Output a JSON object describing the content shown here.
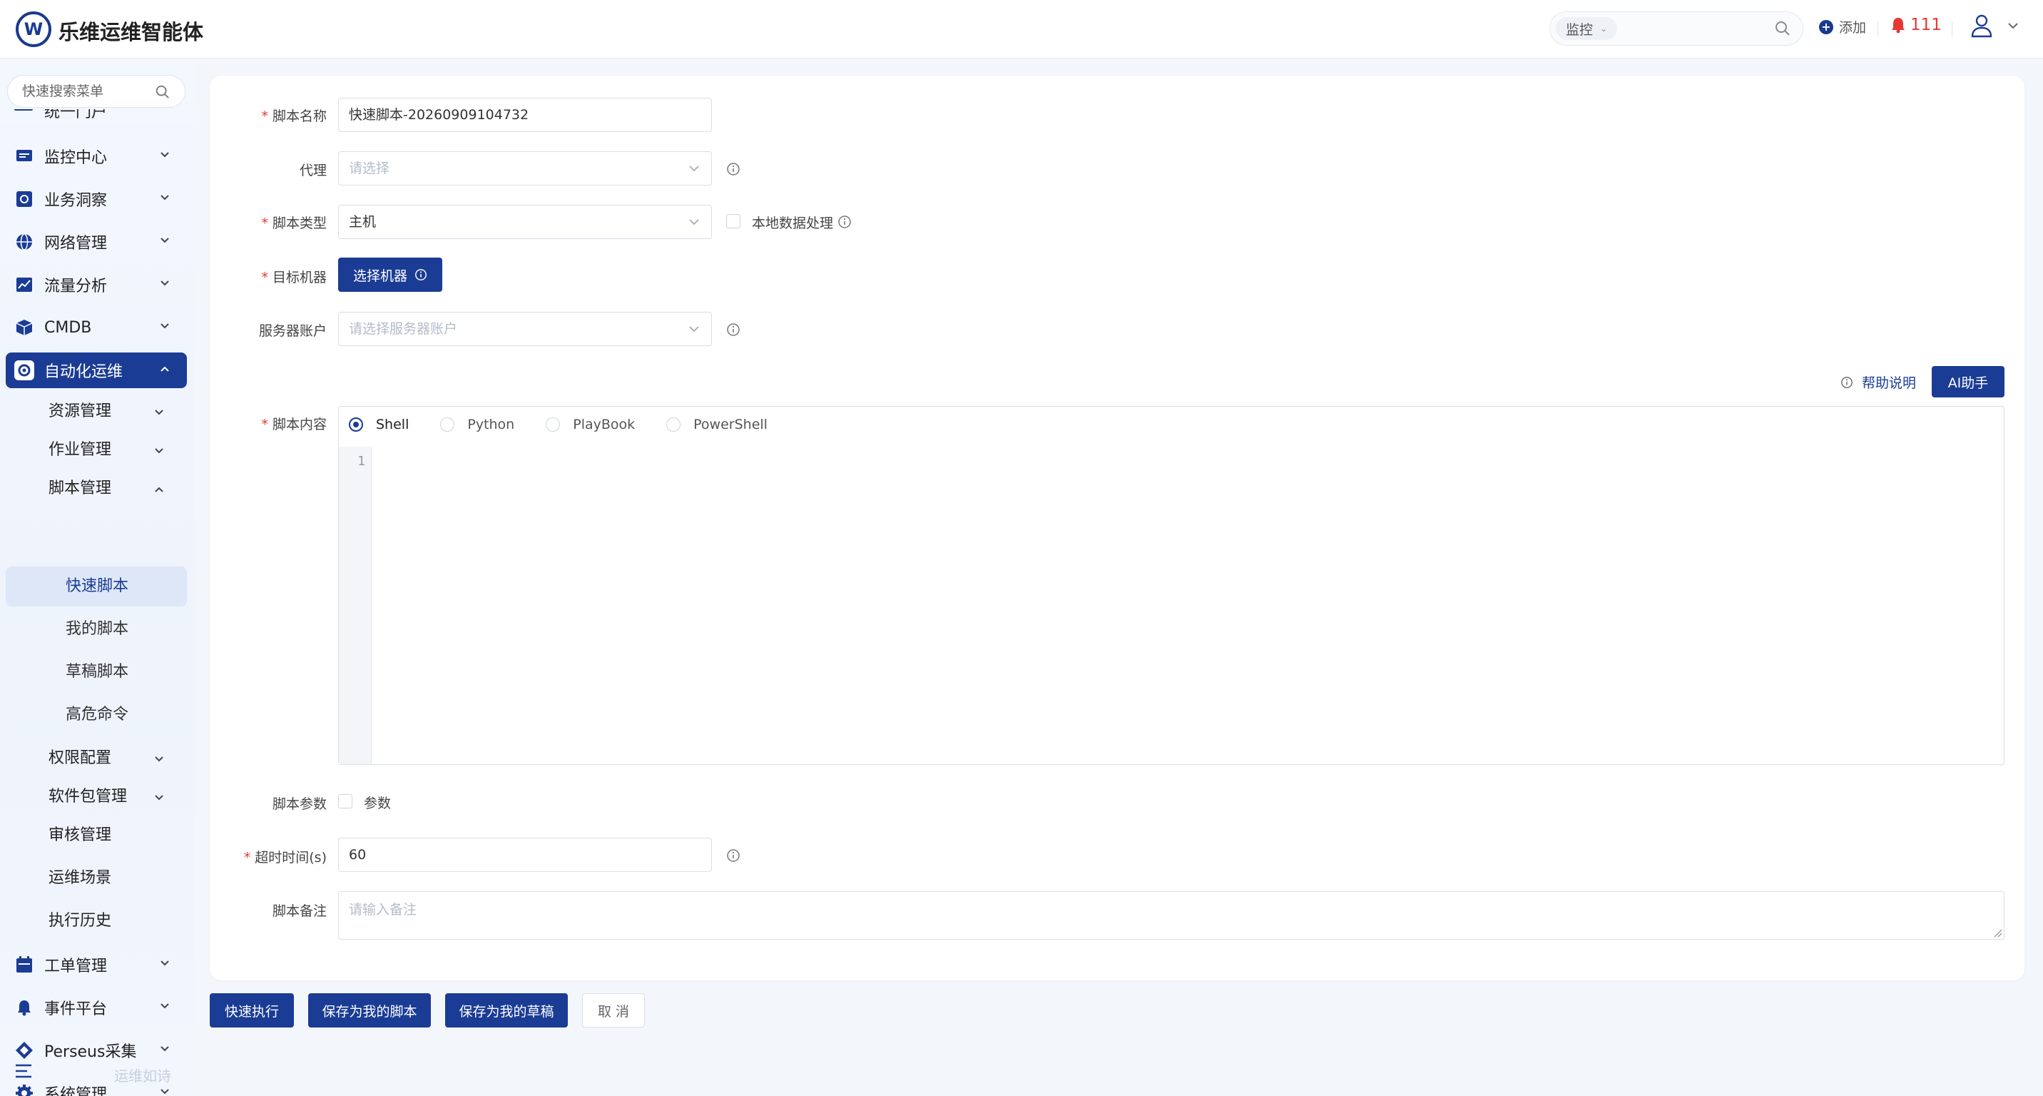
{
  "header": {
    "logo_letter": "W",
    "title": "乐维运维智能体",
    "search_scope": "监控",
    "add_label": "添加",
    "alarm_count": "111"
  },
  "sidebar": {
    "search_placeholder": "快速搜索菜单",
    "partial_item": "统一门户",
    "menus": [
      {
        "label": "监控中心",
        "icon": "monitor-icon"
      },
      {
        "label": "业务洞察",
        "icon": "insight-icon"
      },
      {
        "label": "网络管理",
        "icon": "globe-icon"
      },
      {
        "label": "流量分析",
        "icon": "chart-icon"
      },
      {
        "label": "CMDB",
        "icon": "cube-icon"
      },
      {
        "label": "自动化运维",
        "icon": "automation-icon",
        "active": true
      }
    ],
    "automation_sub": [
      {
        "label": "资源管理"
      },
      {
        "label": "作业管理"
      },
      {
        "label": "脚本管理",
        "expanded": true
      }
    ],
    "script_leaves": [
      "快速脚本",
      "我的脚本",
      "草稿脚本",
      "高危命令"
    ],
    "automation_sub_after": [
      {
        "label": "权限配置",
        "has_children": true
      },
      {
        "label": "软件包管理",
        "has_children": true
      },
      {
        "label": "审核管理",
        "has_children": false
      },
      {
        "label": "运维场景",
        "has_children": false
      },
      {
        "label": "执行历史",
        "has_children": false
      }
    ],
    "menus_after": [
      {
        "label": "工单管理",
        "icon": "calendar-icon"
      },
      {
        "label": "事件平台",
        "icon": "bell-icon"
      },
      {
        "label": "Perseus采集",
        "icon": "diamond-icon"
      },
      {
        "label": "系统管理",
        "icon": "gear-icon"
      }
    ],
    "footer_text": "运维如诗"
  },
  "form": {
    "script_name": {
      "label": "脚本名称",
      "value": "快速脚本-20260909104732",
      "required": true
    },
    "proxy": {
      "label": "代理",
      "placeholder": "请选择",
      "required": false
    },
    "script_type": {
      "label": "脚本类型",
      "value": "主机",
      "required": true
    },
    "local_data": {
      "label": "本地数据处理",
      "checked": false
    },
    "target": {
      "label": "目标机器",
      "button": "选择机器",
      "required": true
    },
    "server_account": {
      "label": "服务器账户",
      "placeholder": "请选择服务器账户",
      "required": false
    },
    "help_label": "帮助说明",
    "ai_label": "AI助手",
    "script_content": {
      "label": "脚本内容",
      "required": true,
      "languages": [
        "Shell",
        "Python",
        "PlayBook",
        "PowerShell"
      ],
      "selected": "Shell",
      "line_number": "1"
    },
    "params": {
      "label": "脚本参数",
      "checkbox_label": "参数",
      "checked": false
    },
    "timeout": {
      "label": "超时时间(s)",
      "value": "60",
      "required": true
    },
    "remark": {
      "label": "脚本备注",
      "placeholder": "请输入备注",
      "required": false
    }
  },
  "actions": {
    "quick_run": "快速执行",
    "save_mine": "保存为我的脚本",
    "save_draft": "保存为我的草稿",
    "cancel": "取 消"
  },
  "colors": {
    "primary": "#1b3c94",
    "required": "#e53935",
    "alarm": "#e53935"
  }
}
